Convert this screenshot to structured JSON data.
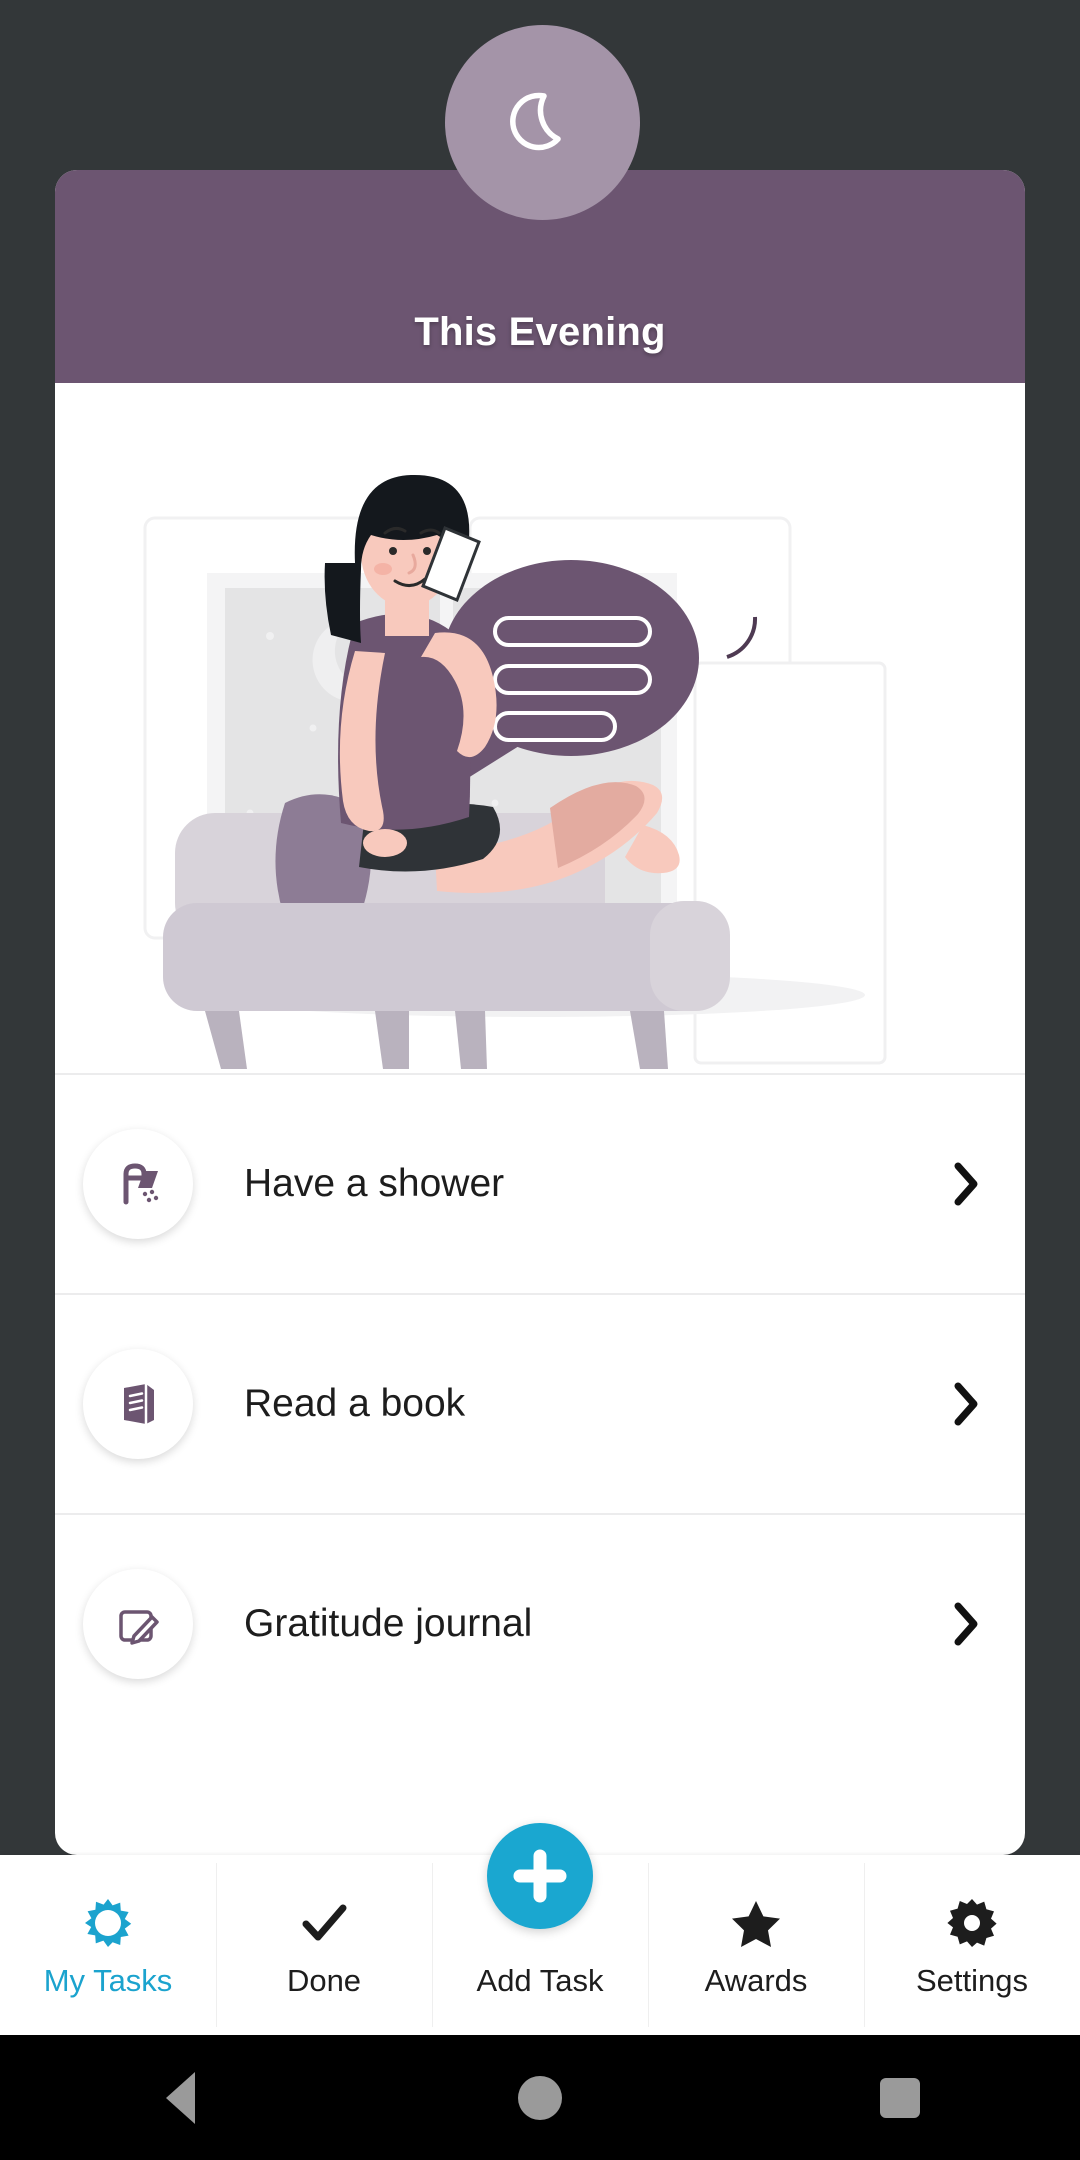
{
  "header": {
    "title": "This Evening",
    "badge_icon": "crescent-moon-icon",
    "band_color": "#6C5571",
    "badge_color": "#A494A8"
  },
  "illustration": {
    "name": "woman-on-sofa-with-phone-illustration",
    "elements": [
      "night-window-with-crescent-moon",
      "speech-bubble-with-three-lines",
      "woman-reclining-on-sofa-holding-phone",
      "floor-mirror",
      "sofa"
    ],
    "accent_color": "#6C5571"
  },
  "tasks": [
    {
      "label": "Have a shower",
      "icon": "shower-icon",
      "chevron": "chevron-right-icon"
    },
    {
      "label": "Read a book",
      "icon": "book-icon",
      "chevron": "chevron-right-icon"
    },
    {
      "label": "Gratitude journal",
      "icon": "edit-note-icon",
      "chevron": "chevron-right-icon"
    }
  ],
  "bottom_nav": {
    "active_color": "#1BA3CE",
    "inactive_color": "#1D1D1D",
    "fab_color": "#1AA7D0",
    "items": [
      {
        "label": "My Tasks",
        "icon": "sun-icon",
        "active": true
      },
      {
        "label": "Done",
        "icon": "check-icon",
        "active": false
      },
      {
        "label": "Add Task",
        "icon": "plus-icon",
        "active": false
      },
      {
        "label": "Awards",
        "icon": "star-icon",
        "active": false
      },
      {
        "label": "Settings",
        "icon": "gear-icon",
        "active": false
      }
    ]
  },
  "system_nav": {
    "back": "back-triangle-icon",
    "home": "home-circle-icon",
    "recents": "recents-square-icon"
  }
}
